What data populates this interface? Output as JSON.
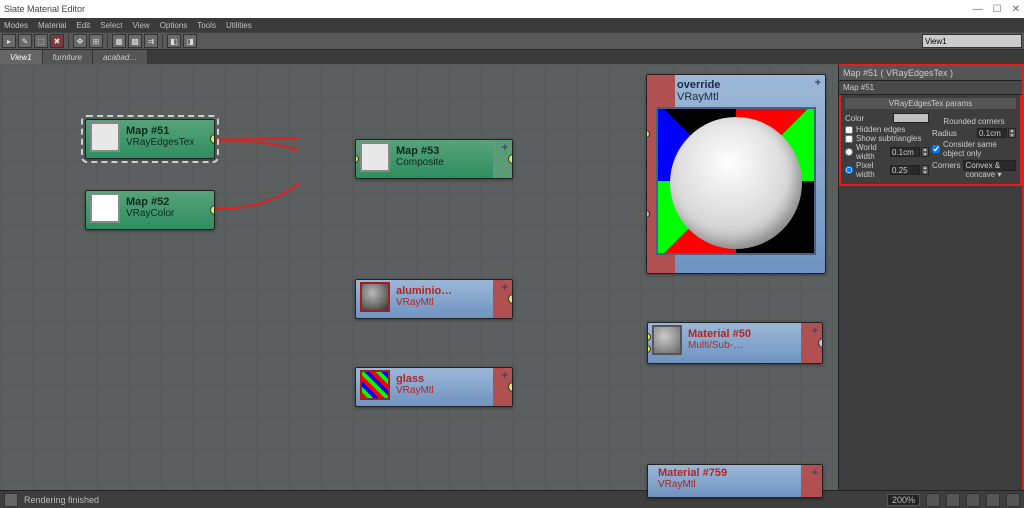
{
  "title": "Slate Material Editor",
  "menu": [
    "Modes",
    "Material",
    "Edit",
    "Select",
    "View",
    "Options",
    "Tools",
    "Utilities"
  ],
  "view_selector": "View1",
  "tabs": [
    {
      "label": "View1",
      "active": true
    },
    {
      "label": "furniture",
      "active": false
    },
    {
      "label": "acabad…",
      "active": false
    }
  ],
  "nodes": {
    "map51": {
      "title": "Map #51",
      "type": "VRayEdgesTex"
    },
    "map52": {
      "title": "Map #52",
      "type": "VRayColor"
    },
    "map53": {
      "title": "Map #53",
      "type": "Composite"
    },
    "alum": {
      "title": "aluminio…",
      "type": "VRayMtl"
    },
    "glass": {
      "title": "glass",
      "type": "VRayMtl"
    },
    "override": {
      "title": "override",
      "type": "VRayMtl"
    },
    "mat50": {
      "title": "Material #50",
      "type": "Multi/Sub-…"
    },
    "mat759": {
      "title": "Material #759",
      "type": "VRayMtl"
    }
  },
  "panel": {
    "title": "Map #51 ( VRayEdgesTex )",
    "name": "Map #51",
    "section": "VRayEdgesTex params",
    "rounded_header": "Rounded corners",
    "color_label": "Color",
    "hidden_edges": "Hidden edges",
    "show_subtriangles": "Show subtriangles",
    "world_width": "World width",
    "world_width_val": "0.1cm",
    "pixel_width": "Pixel width",
    "pixel_width_val": "0.25",
    "radius": "Radius",
    "radius_val": "0.1cm",
    "consider": "Consider same object only",
    "corners": "Corners",
    "corners_val": "Convex & concave"
  },
  "status": {
    "text": "Rendering finished",
    "zoom": "200%"
  }
}
